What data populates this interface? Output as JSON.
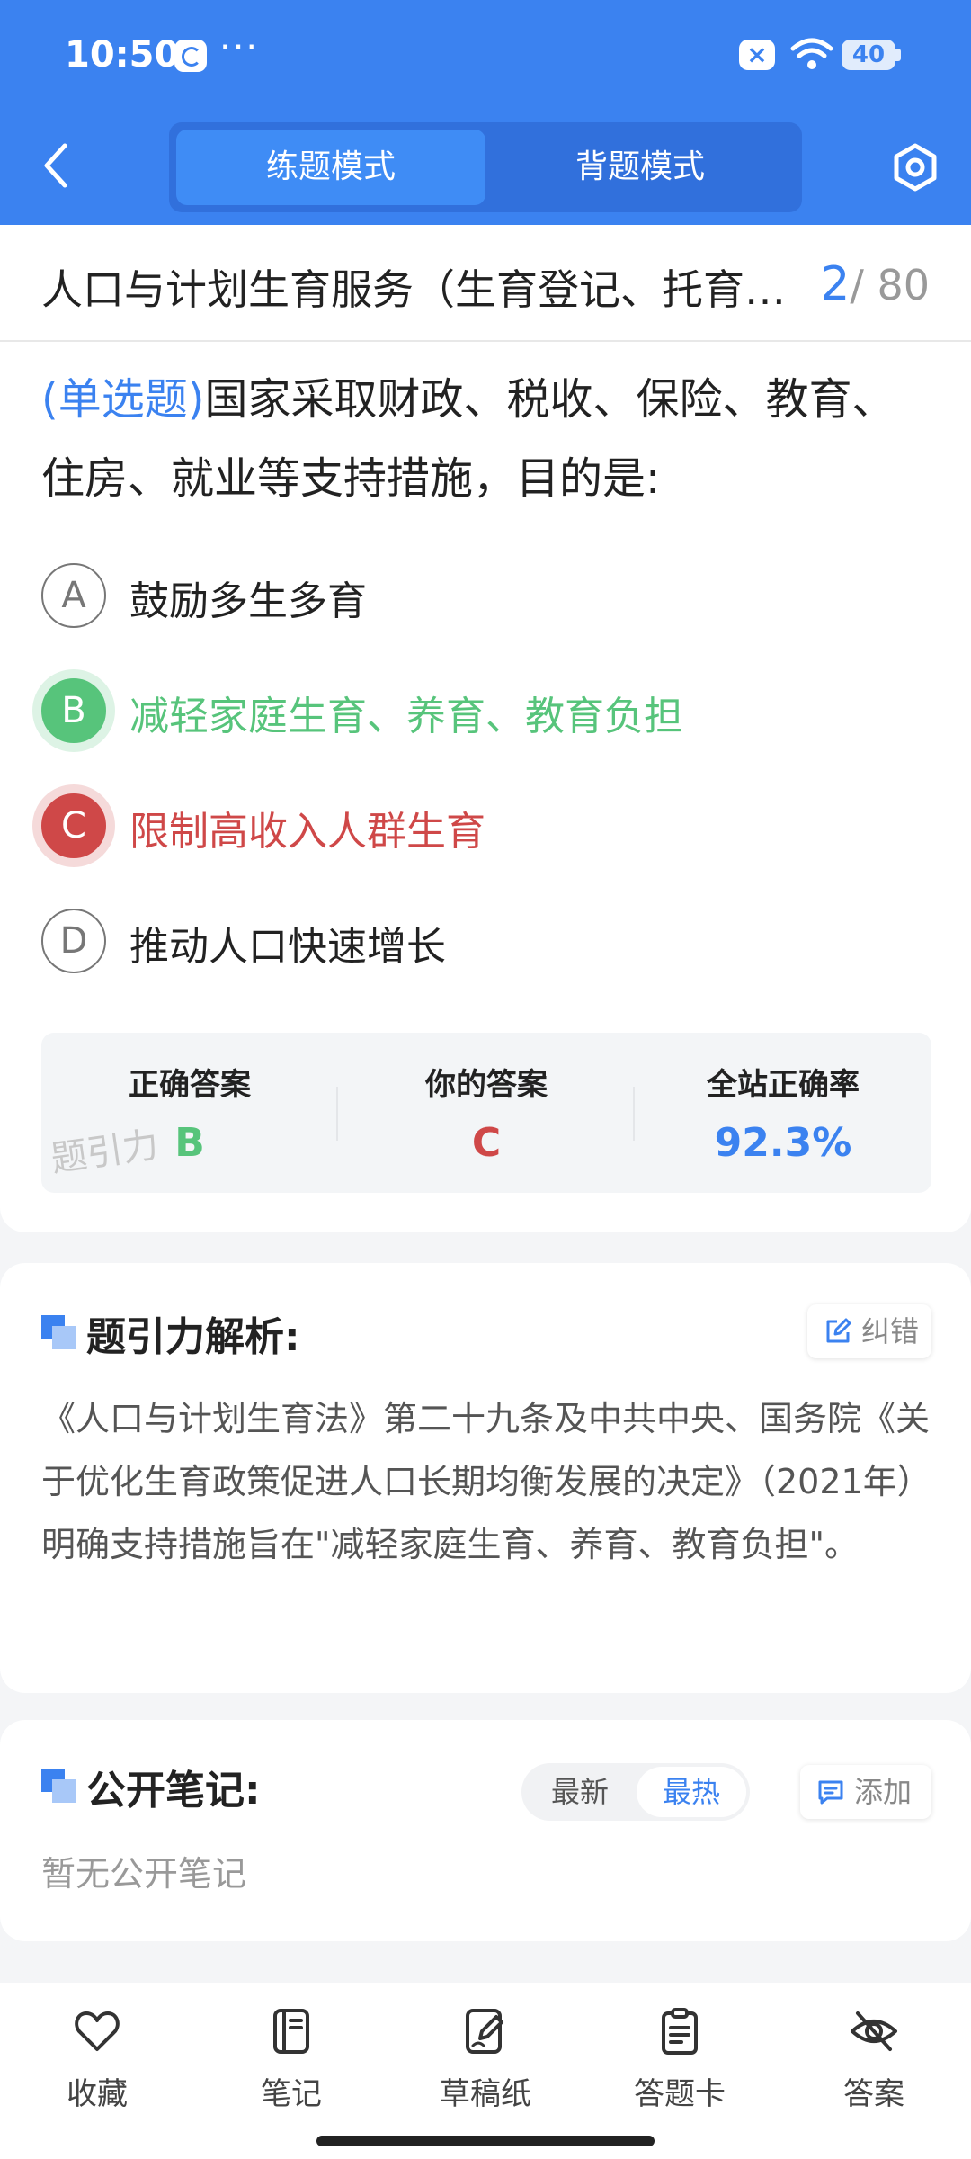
{
  "status_bar": {
    "time": "10:50",
    "dots": "···",
    "battery": "40"
  },
  "header": {
    "modes": [
      "练题模式",
      "背题模式"
    ]
  },
  "topic": {
    "title": "人口与计划生育服务（生育登记、托育服务、生育支持）",
    "current": "2",
    "total": "/ 80"
  },
  "question": {
    "type": "(单选题)",
    "text": "国家采取财政、税收、保险、教育、住房、就业等支持措施，目的是:",
    "options": [
      {
        "letter": "A",
        "text": "鼓励多生多育",
        "state": "normal"
      },
      {
        "letter": "B",
        "text": "减轻家庭生育、养育、教育负担",
        "state": "correct"
      },
      {
        "letter": "C",
        "text": "限制高收入人群生育",
        "state": "wrong"
      },
      {
        "letter": "D",
        "text": "推动人口快速增长",
        "state": "normal"
      }
    ]
  },
  "stats": {
    "correct_label": "正确答案",
    "correct_value": "B",
    "yours_label": "你的答案",
    "yours_value": "C",
    "rate_label": "全站正确率",
    "rate_value": "92.3%",
    "watermark": "题引力"
  },
  "analysis": {
    "title": "题引力解析:",
    "report_label": "纠错",
    "text": "《人口与计划生育法》第二十九条及中共中央、国务院《关于优化生育政策促进人口长期均衡发展的决定》（2021年）明确支持措施旨在\"减轻家庭生育、养育、教育负担\"。"
  },
  "notes": {
    "title": "公开笔记:",
    "sort_latest": "最新",
    "sort_hot": "最热",
    "add_label": "添加",
    "empty": "暂无公开笔记"
  },
  "bottom_nav": [
    {
      "label": "收藏",
      "icon": "heart-icon"
    },
    {
      "label": "笔记",
      "icon": "notebook-icon"
    },
    {
      "label": "草稿纸",
      "icon": "draft-icon"
    },
    {
      "label": "答题卡",
      "icon": "answer-card-icon"
    },
    {
      "label": "答案",
      "icon": "eye-off-icon"
    }
  ],
  "colors": {
    "primary": "#3b82f0",
    "correct": "#57c47b",
    "wrong": "#cf4848"
  }
}
